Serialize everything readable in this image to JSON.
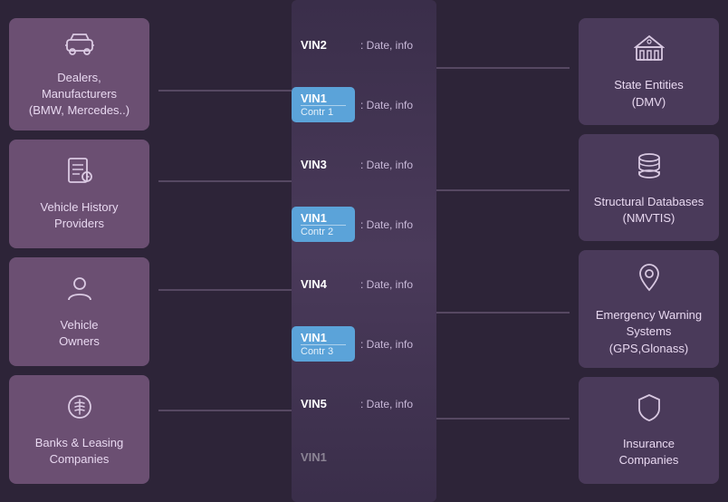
{
  "left": {
    "boxes": [
      {
        "id": "dealers",
        "icon": "car",
        "label": "Dealers, Manufacturers\n(BMW, Mercedes..)"
      },
      {
        "id": "history-providers",
        "icon": "history",
        "label": "Vehicle History\nProviders"
      },
      {
        "id": "vehicle-owners",
        "icon": "owner",
        "label": "Vehicle\nOwners"
      },
      {
        "id": "banks",
        "icon": "bank",
        "label": "Banks & Leasing\nCompanies"
      }
    ]
  },
  "center": {
    "items": [
      {
        "vin": "VIN2",
        "sub": null,
        "highlighted": false,
        "label": ": Date, info"
      },
      {
        "vin": "VIN1",
        "sub": "Contr 1",
        "highlighted": true,
        "label": ": Date, info"
      },
      {
        "vin": "VIN3",
        "sub": null,
        "highlighted": false,
        "label": ": Date, info"
      },
      {
        "vin": "VIN1",
        "sub": "Contr 2",
        "highlighted": true,
        "label": ": Date, info"
      },
      {
        "vin": "VIN4",
        "sub": null,
        "highlighted": false,
        "label": ": Date, info"
      },
      {
        "vin": "VIN1",
        "sub": "Contr 3",
        "highlighted": true,
        "label": ": Date, info"
      },
      {
        "vin": "VIN5",
        "sub": null,
        "highlighted": false,
        "label": ": Date, info"
      },
      {
        "vin": "VIN1",
        "sub": null,
        "highlighted": false,
        "label": ""
      }
    ]
  },
  "right": {
    "boxes": [
      {
        "id": "state-entities",
        "icon": "govt",
        "label": "State Entities\n(DMV)"
      },
      {
        "id": "structural-db",
        "icon": "db",
        "label": "Structural Databases\n(NMVTIS)"
      },
      {
        "id": "gps",
        "icon": "gps",
        "label": "Emergency Warning\nSystems (GPS,Glonass)"
      },
      {
        "id": "insurance",
        "icon": "insurance",
        "label": "Insurance\nCompanies"
      }
    ]
  },
  "colors": {
    "leftBox": "#6b4f72",
    "rightBox": "#4a3a5a",
    "highlighted": "#5ba3d9",
    "bg": "#2d2438",
    "centerBg": "#3d3050",
    "text": "#e8d8f0",
    "dimText": "#c8b8d8",
    "line": "#7a6a8a"
  }
}
